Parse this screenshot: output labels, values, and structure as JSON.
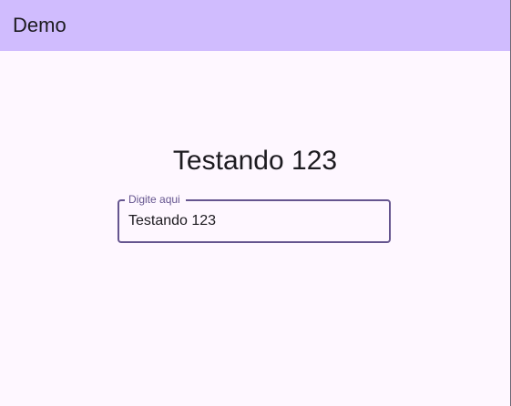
{
  "app_bar": {
    "title": "Demo"
  },
  "main": {
    "headline": "Testando 123",
    "text_field": {
      "label": "Digite aqui",
      "value": "Testando 123"
    }
  },
  "colors": {
    "app_bar_background": "#d0bcfe",
    "page_background": "#fef7ff",
    "field_border_focused": "#65558f",
    "text_primary": "#1d1b20"
  }
}
